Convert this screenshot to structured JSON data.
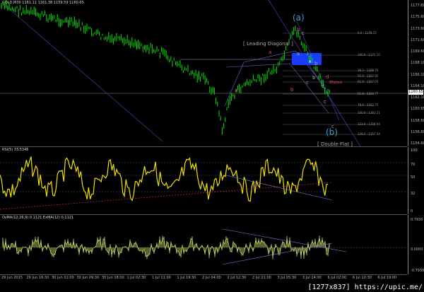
{
  "main": {
    "title": "GOLD,M30  1161.11 1161.38 1159.59 1160.65",
    "labels": {
      "wave_a_top": "(a)",
      "wave_b_bottom": "(b)",
      "leading_diagonal": "[ Leading Diagonal ]",
      "double_flat": "[ Double Flat ]",
      "failed": "failed",
      "x": "x"
    },
    "wave_marks": [
      "a",
      "b",
      "c",
      "a",
      "b",
      "c",
      "c",
      "b",
      "a",
      "b",
      "c",
      "d",
      "e",
      "c"
    ],
    "fib_levels": [
      "0.0 : 1176.72",
      "100.0 : 1171.10",
      "38.2 : 1168.76",
      "50.0 : 1167.92",
      "61.8 : 1167.05",
      "61.8 : 1164.77",
      "78.6 : 1162.75",
      "100.0 : 1161.21",
      "123.6 : 1158.94",
      "138.2 : 1157.44"
    ],
    "price_axis": [
      "1177.60",
      "1175.60",
      "1173.60",
      "1171.60",
      "1169.60",
      "1168.10",
      "1166.10",
      "1164.10",
      "1162.10",
      "1160.65",
      "1158.60",
      "1156.60",
      "1154.60"
    ],
    "current_price": "1160.65",
    "colors": {
      "up_candle": "#00c800",
      "down_candle": "#00c800",
      "wave_cyan": "#3aa0d8",
      "wave_pink": "#e0407a",
      "box": "#1a3cff"
    }
  },
  "rsi": {
    "title": "RSI(5) 33.5346",
    "axis": [
      "100",
      "70",
      "50",
      "32",
      "0"
    ]
  },
  "osma": {
    "title": "OsMA(12,26,9) 0.1121  ExMA(12) 0.1121",
    "axis": [
      "0.7930",
      "0.0000",
      "-0.7930"
    ]
  },
  "time_axis": [
    "29 Jun 2015",
    "29 Jun 16:30",
    "30 Jun 01:00",
    "30 Jun 09:30",
    "30 Jun 18:00",
    "1 Jul 02:30",
    "1 Jul 11:00",
    "1 Jul 19:30",
    "2 Jul 04:00",
    "2 Jul 12:30",
    "2 Jul 21:00",
    "3 Jul 05:30",
    "3 Jul 14:00",
    "6 Jul 02:00",
    "6 Jul 10:30",
    "6 Jul 19:00"
  ],
  "watermark": "[1277x837] https://upic.me/"
}
